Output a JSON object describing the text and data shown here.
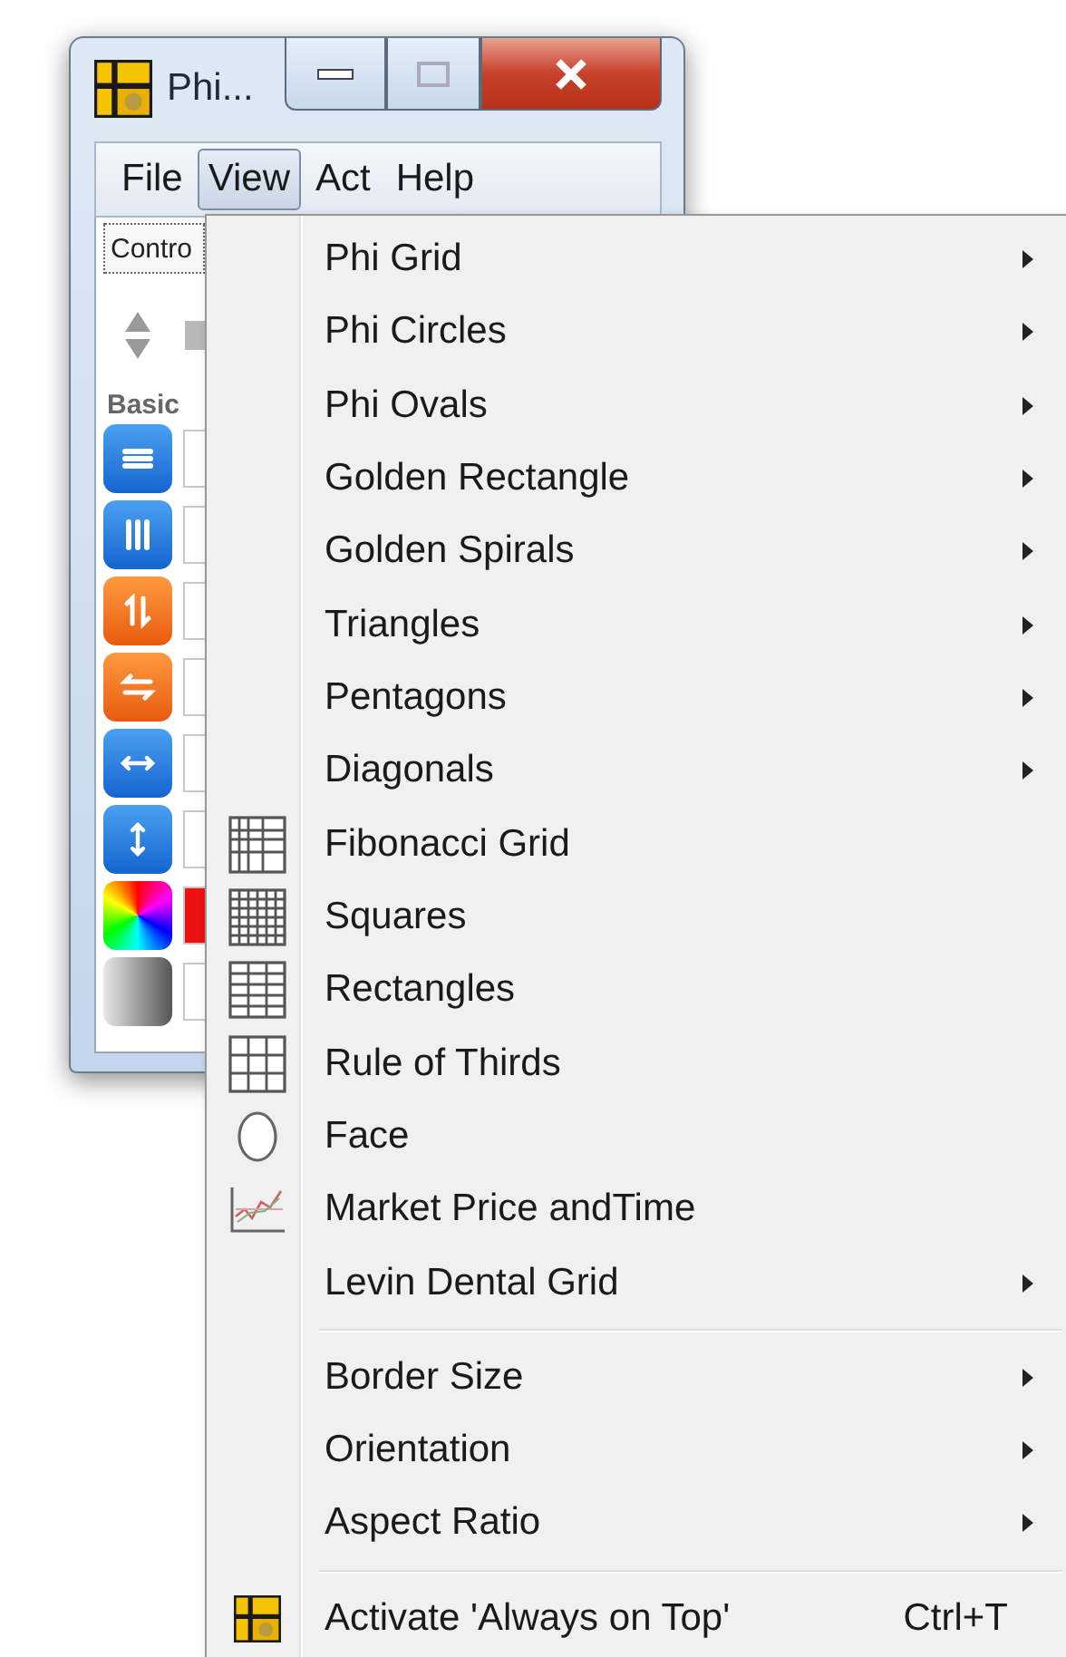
{
  "window": {
    "title": "Phi...",
    "menus": [
      {
        "label": "File",
        "selected": false
      },
      {
        "label": "View",
        "selected": true
      },
      {
        "label": "Act",
        "selected": false
      },
      {
        "label": "Help",
        "selected": false
      }
    ],
    "tab": "Contro",
    "section": "Basic",
    "tools": [
      {
        "kind": "rows"
      },
      {
        "kind": "columns"
      },
      {
        "kind": "flipv"
      },
      {
        "kind": "fliph"
      },
      {
        "kind": "widen"
      },
      {
        "kind": "heighten"
      },
      {
        "kind": "wheel",
        "color": "#ee1111"
      },
      {
        "kind": "gradient"
      }
    ]
  },
  "menu": {
    "groups": [
      [
        {
          "label": "Phi Grid",
          "kind": "submenu"
        },
        {
          "label": "Phi Circles",
          "kind": "submenu"
        },
        {
          "label": "Phi Ovals",
          "kind": "submenu"
        },
        {
          "label": "Golden Rectangle",
          "kind": "submenu"
        },
        {
          "label": "Golden Spirals",
          "kind": "submenu"
        },
        {
          "label": "Triangles",
          "kind": "submenu"
        },
        {
          "label": "Pentagons",
          "kind": "submenu"
        },
        {
          "label": "Diagonals",
          "kind": "submenu"
        },
        {
          "label": "Fibonacci Grid",
          "kind": "fibonacci"
        },
        {
          "label": "Squares",
          "kind": "squares"
        },
        {
          "label": "Rectangles",
          "kind": "rectangles"
        },
        {
          "label": "Rule of Thirds",
          "kind": "thirds"
        },
        {
          "label": "Face",
          "kind": "head"
        },
        {
          "label": "Market Price andTime",
          "kind": "chart"
        },
        {
          "label": "Levin Dental Grid",
          "kind": "submenu"
        }
      ],
      [
        {
          "label": "Border Size",
          "kind": "submenu"
        },
        {
          "label": "Orientation",
          "kind": "submenu"
        },
        {
          "label": "Aspect Ratio",
          "kind": "submenu"
        }
      ],
      [
        {
          "label": "Activate 'Always on Top'",
          "kind": "app",
          "shortcut": "Ctrl+T"
        }
      ]
    ]
  }
}
